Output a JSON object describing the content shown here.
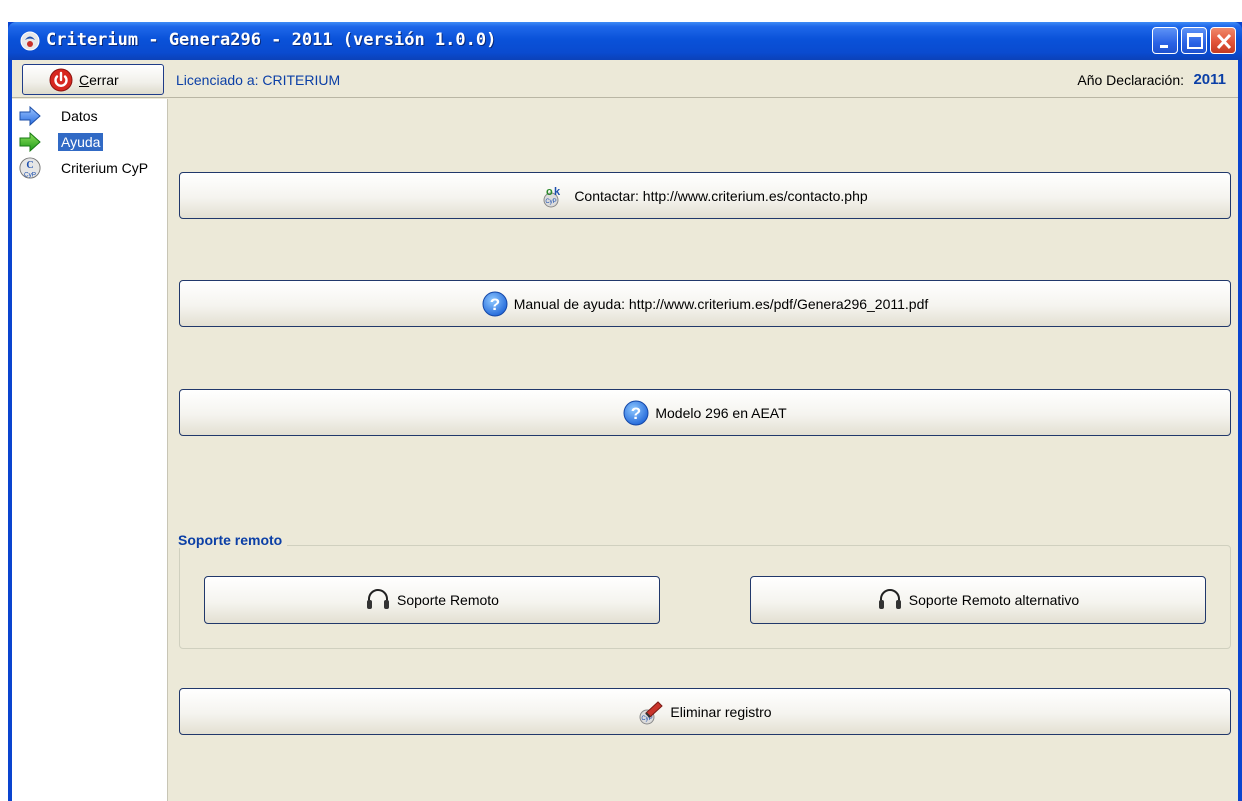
{
  "window": {
    "title": "Criterium - Genera296 - 2011 (versión 1.0.0)",
    "icon": "criterium-app-icon",
    "caption_buttons": [
      "minimize-icon",
      "maximize-icon",
      "close-icon"
    ]
  },
  "toolbar": {
    "close_label_first": "C",
    "close_label_rest": "errar",
    "close_icon": "power-icon",
    "license_text": "Licenciado a: CRITERIUM",
    "year_label": "Año Declaración:",
    "year_value": "2011"
  },
  "sidebar": {
    "items": [
      {
        "label": "Datos",
        "icon": "blue-arrow-icon",
        "selected": false
      },
      {
        "label": "Ayuda",
        "icon": "green-arrow-icon",
        "selected": true
      },
      {
        "label": "Criterium CyP",
        "icon": "criterium-cyp-icon",
        "selected": false
      }
    ]
  },
  "main": {
    "contact_label": "Contactar: http://www.criterium.es/contacto.php",
    "manual_label": "Manual de ayuda: http://www.criterium.es/pdf/Genera296_2011.pdf",
    "modelo_label": "Modelo 296 en AEAT",
    "remote_group_title": "Soporte remoto",
    "remote_label": "Soporte Remoto",
    "remote_alt_label": "Soporte Remoto alternativo",
    "delete_label": "Eliminar registro"
  },
  "colors": {
    "title_bar": "#0a52d9",
    "accent_text": "#0b3fa6",
    "selection": "#316ac5",
    "client_bg": "#ece9d8"
  }
}
